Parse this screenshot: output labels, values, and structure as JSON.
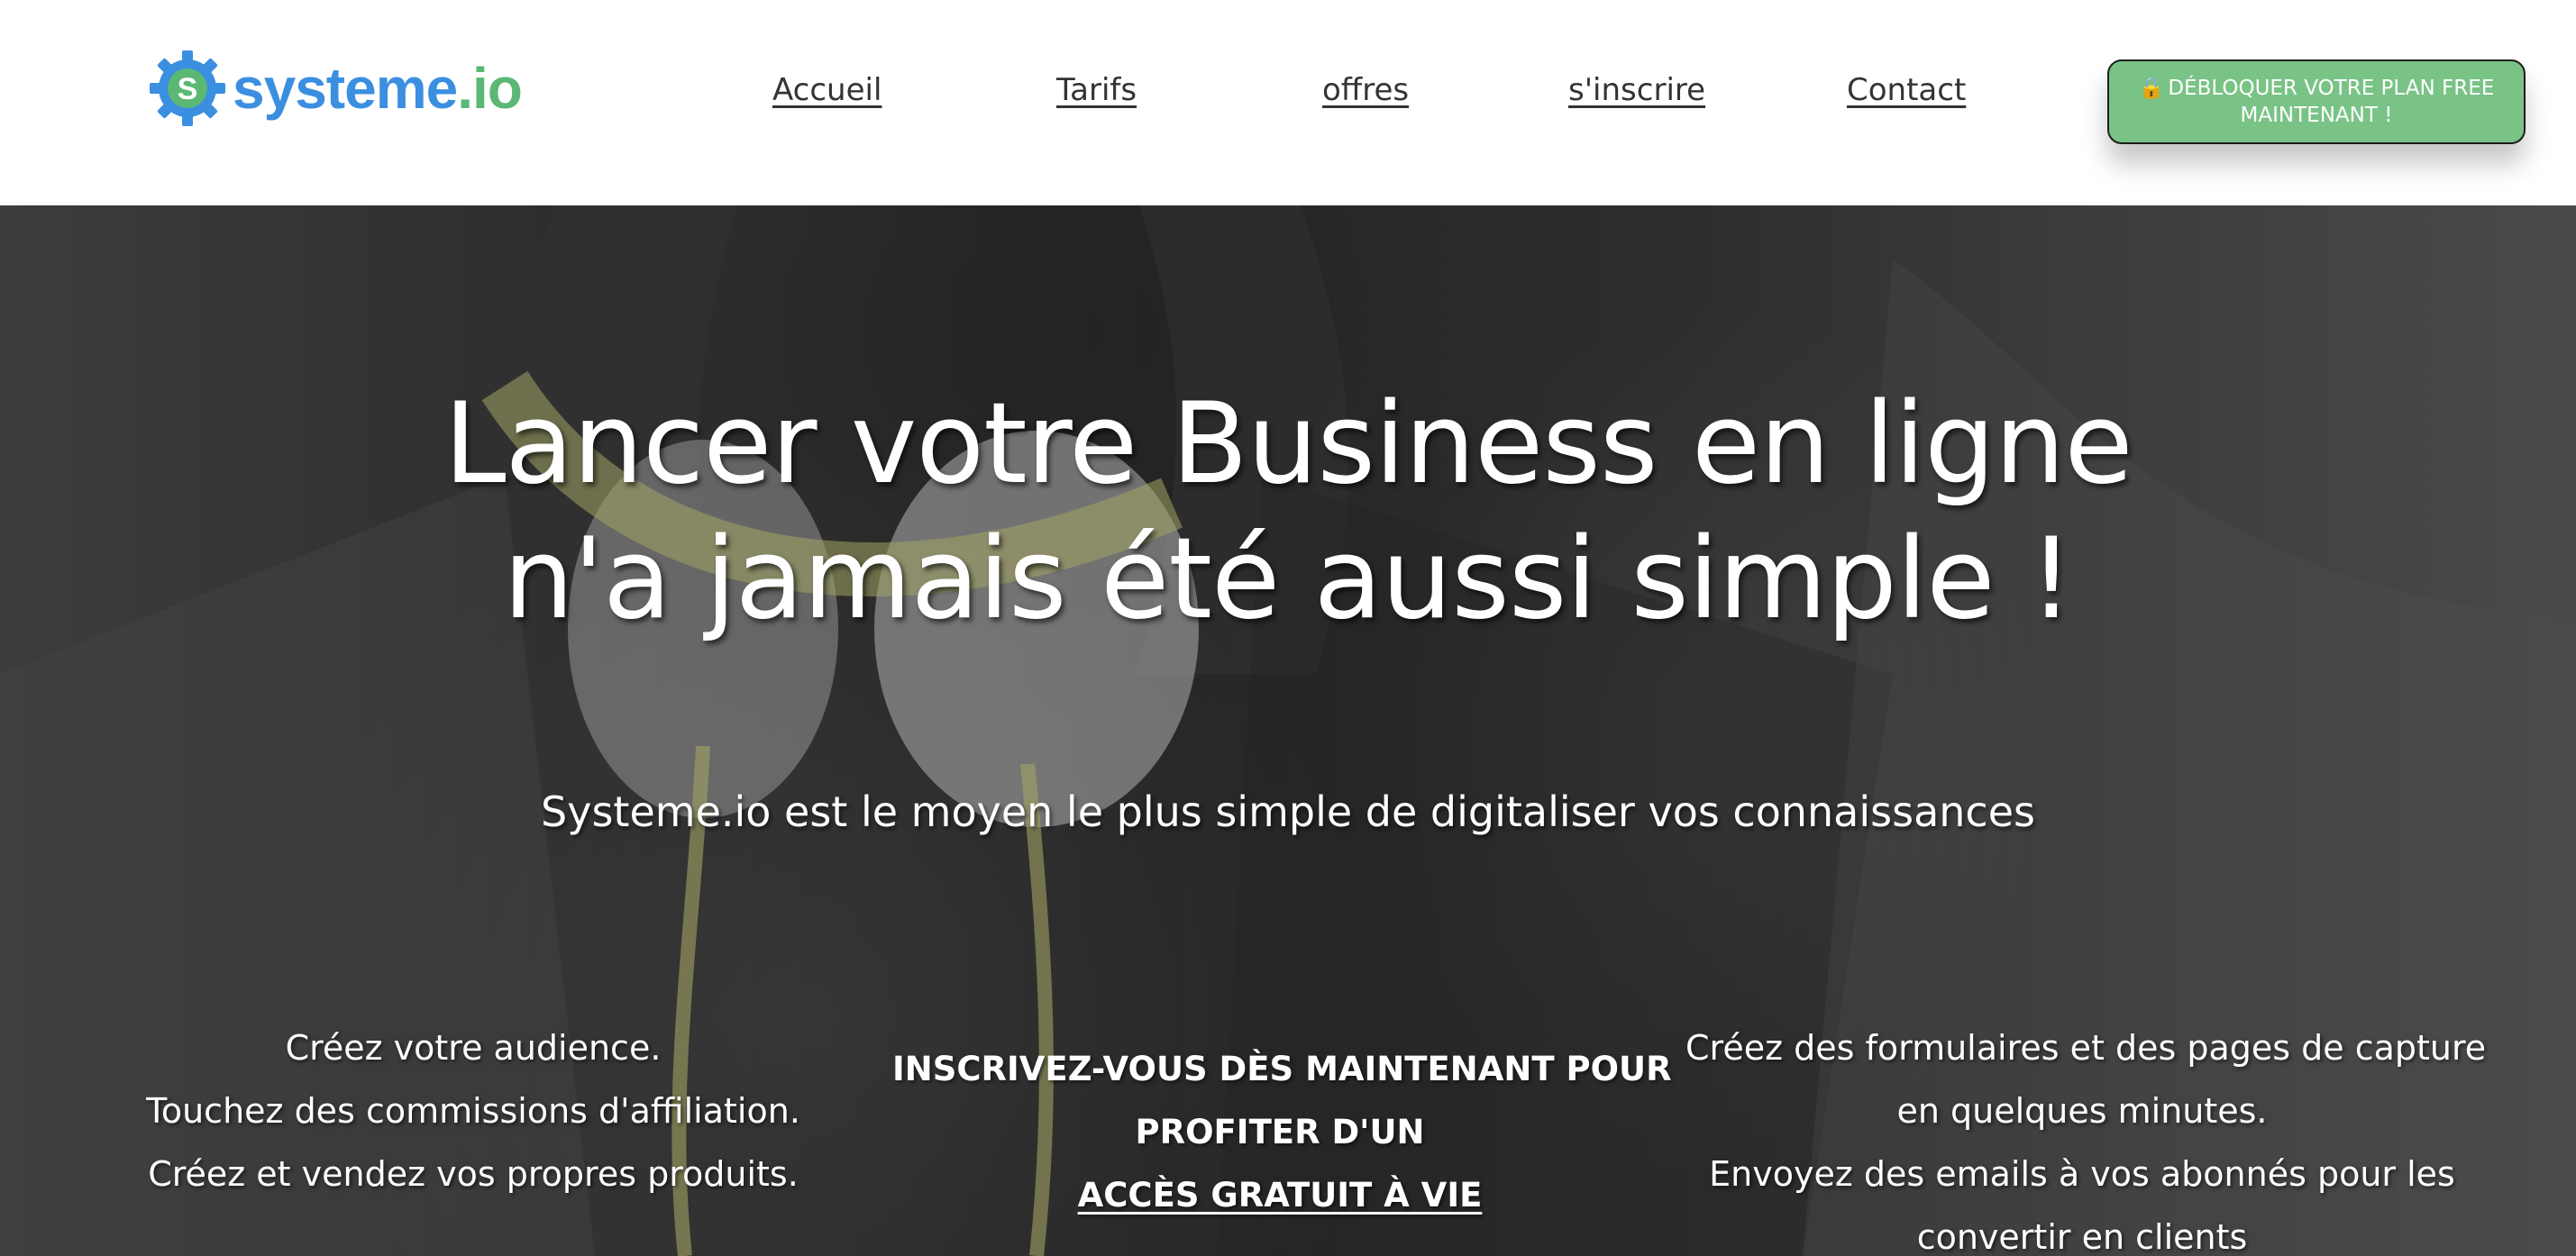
{
  "brand": {
    "logo_text_primary": "systeme",
    "logo_text_secondary": ".io",
    "logo_letter": "S",
    "colors": {
      "blue": "#3b8fe0",
      "green": "#5ab874"
    }
  },
  "nav": {
    "items": [
      {
        "label": "Accueil"
      },
      {
        "label": "Tarifs"
      },
      {
        "label": "offres"
      },
      {
        "label": "s'inscrire"
      },
      {
        "label": "Contact"
      }
    ]
  },
  "cta": {
    "icon": "lock-icon",
    "label_line1": "DÉBLOQUER VOTRE PLAN FREE",
    "label_line2": "MAINTENANT !",
    "color": "#79c386"
  },
  "hero": {
    "title_line1": "Lancer votre Business en ligne",
    "title_line2": "n'a jamais été aussi simple !",
    "subtitle": "Systeme.io est le moyen le plus simple de digitaliser vos connaissances",
    "left_lines": [
      "Créez votre audience.",
      "Touchez des commissions d'affiliation.",
      "Créez et vendez vos propres produits."
    ],
    "center_line1": "INSCRIVEZ-VOUS DÈS MAINTENANT POUR",
    "center_line2": "PROFITER D'UN",
    "center_link": "ACCÈS GRATUIT À VIE",
    "right_lines": [
      "Créez des formulaires et des pages de capture",
      "en quelques minutes.",
      "Envoyez des emails à vos abonnés pour les",
      "convertir en clients"
    ]
  }
}
